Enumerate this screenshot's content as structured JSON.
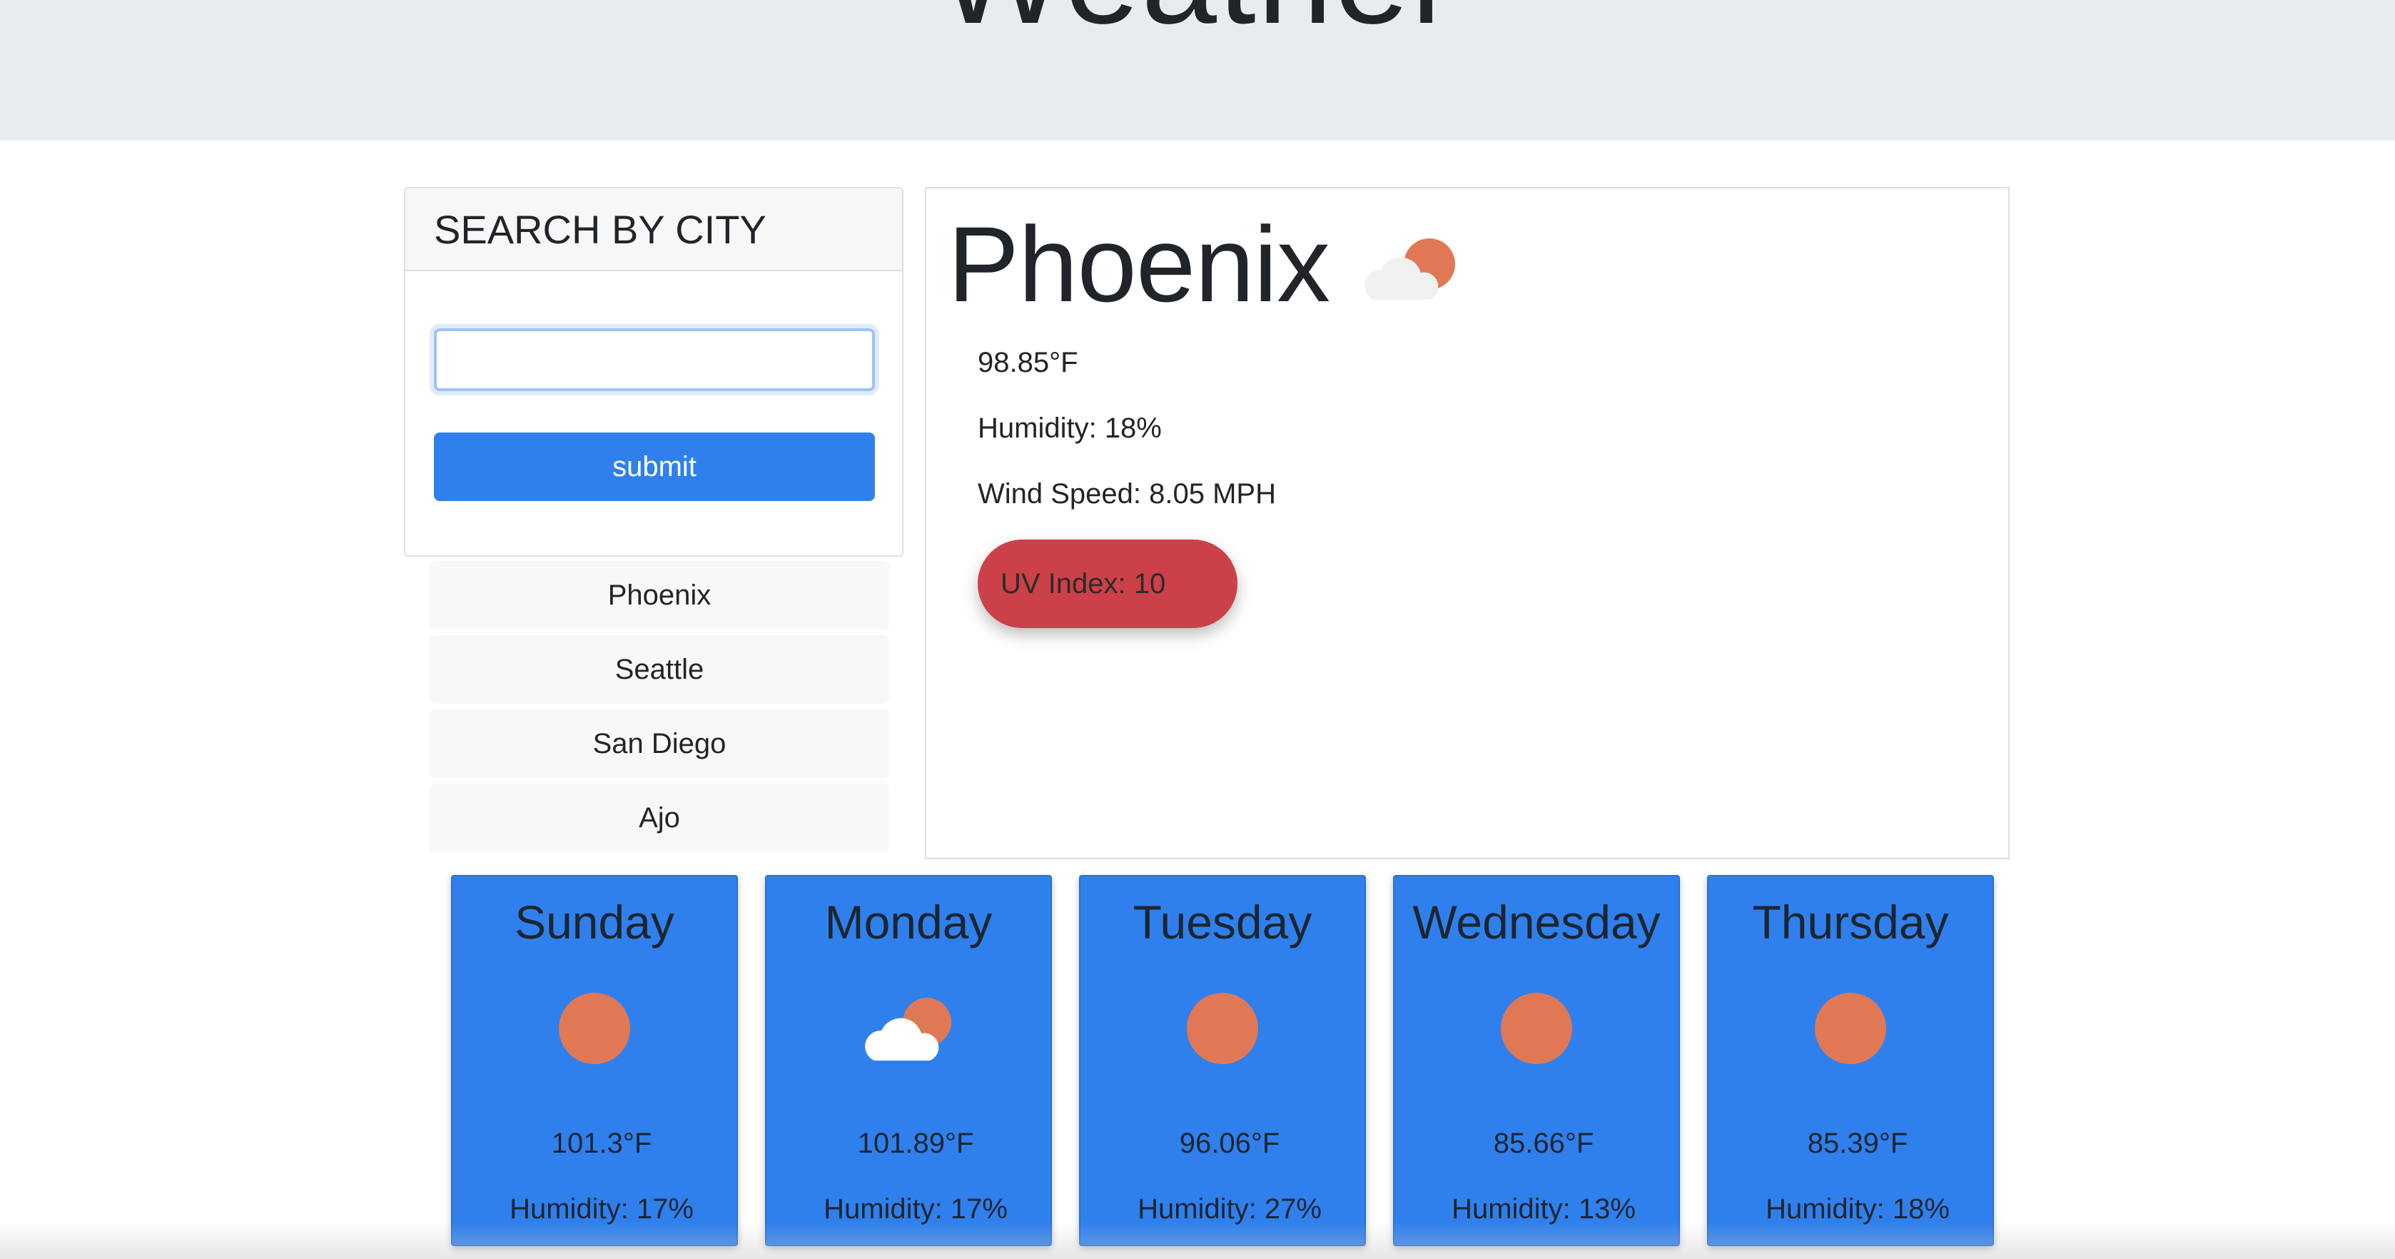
{
  "header": {
    "title": "Weather"
  },
  "search": {
    "heading": "SEARCH BY CITY",
    "input_value": "",
    "submit_label": "submit"
  },
  "history": [
    "Phoenix",
    "Seattle",
    "San Diego",
    "Ajo"
  ],
  "current": {
    "city": "Phoenix",
    "icon": "partly-cloudy-icon",
    "temperature": "98.85°F",
    "humidity": "Humidity: 18%",
    "wind": "Wind Speed: 8.05 MPH",
    "uv": "UV Index: 10",
    "uv_color": "#cc4049"
  },
  "forecast": [
    {
      "day": "Sunday",
      "icon": "sun-icon",
      "temp": "101.3°F",
      "humidity": "Humidity: 17%"
    },
    {
      "day": "Monday",
      "icon": "partly-cloudy-icon",
      "temp": "101.89°F",
      "humidity": "Humidity: 17%"
    },
    {
      "day": "Tuesday",
      "icon": "sun-icon",
      "temp": "96.06°F",
      "humidity": "Humidity: 27%"
    },
    {
      "day": "Wednesday",
      "icon": "sun-icon",
      "temp": "85.66°F",
      "humidity": "Humidity: 13%"
    },
    {
      "day": "Thursday",
      "icon": "sun-icon",
      "temp": "85.39°F",
      "humidity": "Humidity: 18%"
    }
  ],
  "colors": {
    "accent": "#2f80ed",
    "header_bg": "#e9ecef",
    "sun": "#e07856",
    "cloud": "#f2f2f2"
  }
}
